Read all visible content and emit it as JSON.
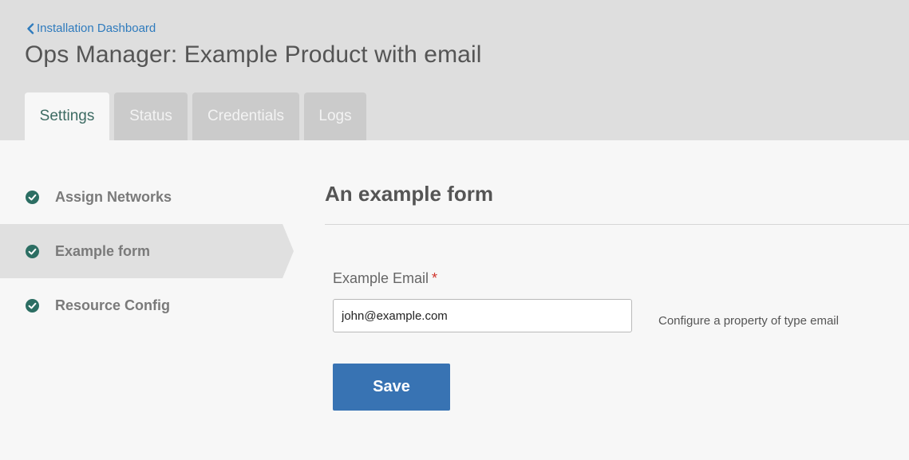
{
  "header": {
    "breadcrumb": "Installation Dashboard",
    "title": "Ops Manager: Example Product with email"
  },
  "tabs": [
    {
      "label": "Settings",
      "active": true
    },
    {
      "label": "Status",
      "active": false
    },
    {
      "label": "Credentials",
      "active": false
    },
    {
      "label": "Logs",
      "active": false
    }
  ],
  "sidebar": {
    "items": [
      {
        "label": "Assign Networks",
        "status": "complete",
        "active": false
      },
      {
        "label": "Example form",
        "status": "complete",
        "active": true
      },
      {
        "label": "Resource Config",
        "status": "complete",
        "active": false
      }
    ]
  },
  "form": {
    "title": "An example form",
    "email_label": "Example Email",
    "required_marker": "*",
    "email_value": "john@example.com",
    "help_text": "Configure a property of type email",
    "save_label": "Save"
  },
  "colors": {
    "accent": "#3873b3",
    "link": "#2f7bbd",
    "check": "#2c6e63",
    "required": "#d0342c"
  },
  "icons": {
    "breadcrumb": "chevron-left-icon",
    "sidebar_status": "check-circle-icon"
  }
}
